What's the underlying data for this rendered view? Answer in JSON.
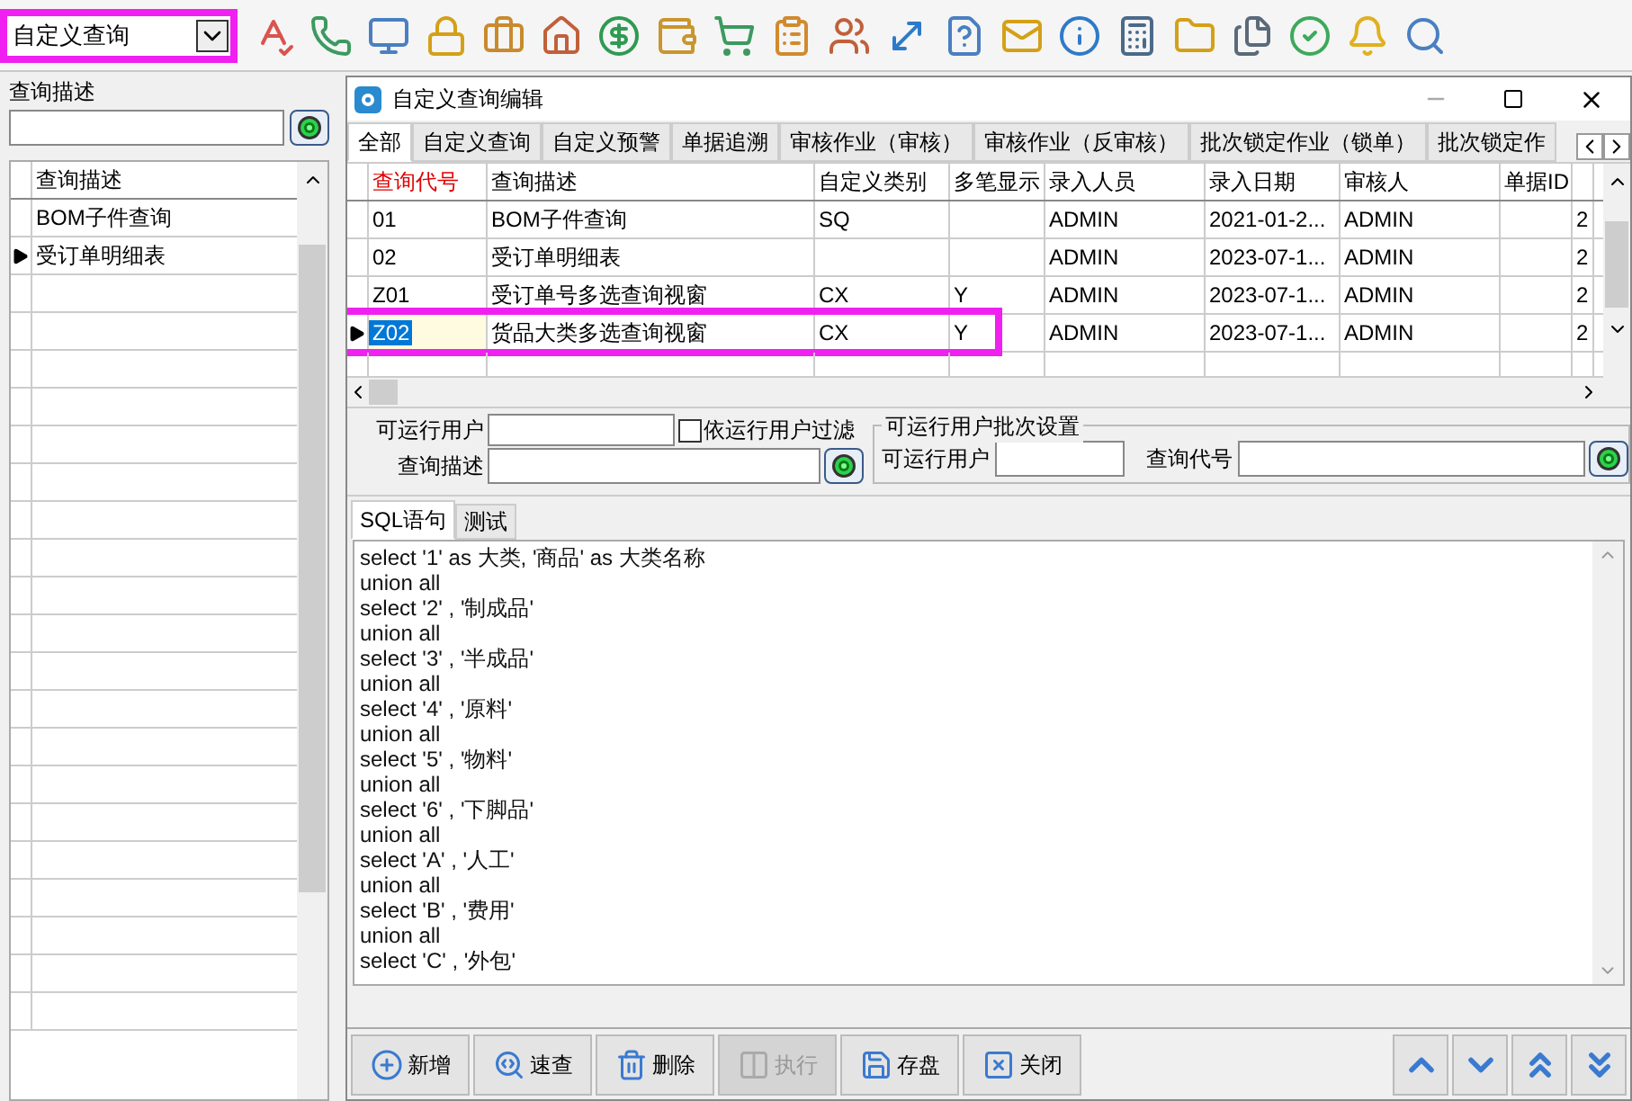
{
  "toolbar": {
    "combo": {
      "value": "自定义查询",
      "annotated": true
    }
  },
  "left_panel": {
    "search_label": "查询描述",
    "grid": {
      "column": "查询描述",
      "rows": [
        {
          "text": "BOM子件查询",
          "current": false
        },
        {
          "text": "受订单明细表",
          "current": true
        }
      ]
    }
  },
  "window": {
    "title": "自定义查询编辑",
    "tabs": [
      {
        "label": "全部",
        "selected": true
      },
      {
        "label": "自定义查询",
        "selected": false
      },
      {
        "label": "自定义预警",
        "selected": false
      },
      {
        "label": "单据追溯",
        "selected": false
      },
      {
        "label": "审核作业（审核）",
        "selected": false
      },
      {
        "label": "审核作业（反审核）",
        "selected": false
      },
      {
        "label": "批次锁定作业（锁单）",
        "selected": false
      },
      {
        "label": "批次锁定作",
        "selected": false
      }
    ],
    "table": {
      "columns": [
        {
          "label": "查询代号",
          "key": true
        },
        {
          "label": "查询描述",
          "key": false
        },
        {
          "label": "自定义类别",
          "key": false
        },
        {
          "label": "多笔显示",
          "key": false
        },
        {
          "label": "录入人员",
          "key": false
        },
        {
          "label": "录入日期",
          "key": false
        },
        {
          "label": "审核人",
          "key": false
        },
        {
          "label": "单据ID",
          "key": false
        },
        {}
      ],
      "rows": [
        {
          "cells": [
            "01",
            "BOM子件查询",
            "SQ",
            "",
            "ADMIN",
            "2021-01-2...",
            "ADMIN",
            "",
            "2"
          ],
          "current": false,
          "annotated": false
        },
        {
          "cells": [
            "02",
            "受订单明细表",
            "",
            "",
            "ADMIN",
            "2023-07-1...",
            "ADMIN",
            "",
            "2"
          ],
          "current": false,
          "annotated": false
        },
        {
          "cells": [
            "Z01",
            "受订单号多选查询视窗",
            "CX",
            "Y",
            "ADMIN",
            "2023-07-1...",
            "ADMIN",
            "",
            "2"
          ],
          "current": false,
          "annotated": false
        },
        {
          "cells": [
            "Z02",
            "货品大类多选查询视窗",
            "CX",
            "Y",
            "ADMIN",
            "2023-07-1...",
            "ADMIN",
            "",
            "2"
          ],
          "current": true,
          "annotated": true
        }
      ]
    },
    "form": {
      "user_label": "可运行用户",
      "filter_checkbox": {
        "label": "依运行用户过滤",
        "checked": false
      },
      "desc_label": "查询描述",
      "batch_group": {
        "title": "可运行用户批次设置",
        "user_label": "可运行用户",
        "code_label": "查询代号"
      }
    },
    "sub_tabs": [
      {
        "label": "SQL语句",
        "selected": true
      },
      {
        "label": "测试",
        "selected": false
      }
    ],
    "sql_lines": [
      "select '1' as 大类, '商品' as 大类名称",
      "union all",
      "select '2' , '制成品'",
      "union all",
      "select '3' , '半成品'",
      "union all",
      "select '4' , '原料'",
      "union all",
      "select '5' , '物料'",
      "union all",
      "select '6' , '下脚品'",
      "union all",
      "select 'A' , '人工'",
      "union all",
      "select 'B' , '费用'",
      "union all",
      "select 'C' , '外包'"
    ],
    "buttons": [
      {
        "label": "新增",
        "disabled": false
      },
      {
        "label": "速查",
        "disabled": false
      },
      {
        "label": "删除",
        "disabled": false
      },
      {
        "label": "执行",
        "disabled": true
      },
      {
        "label": "存盘",
        "disabled": false
      },
      {
        "label": "关闭",
        "disabled": false
      }
    ]
  }
}
